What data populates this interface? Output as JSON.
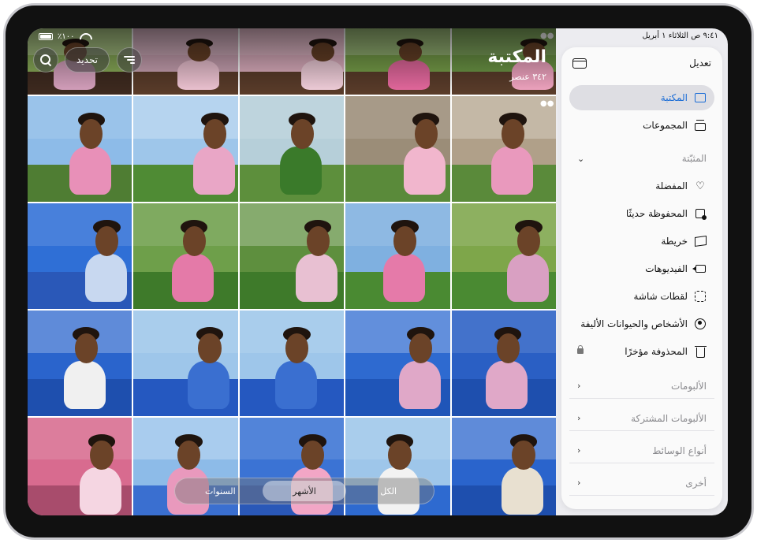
{
  "status": {
    "time_date": "٩:٤١ ص  الثلاثاء ١ أبريل",
    "battery": "٪١٠٠"
  },
  "header": {
    "title": "المكتبة",
    "count": "٣٤٢ عنصر",
    "select_label": "تحديد"
  },
  "bottom_tabs": {
    "all": "الكل",
    "months": "الأشهر",
    "years": "السنوات",
    "selected": "الأشهر"
  },
  "sidebar": {
    "edit_label": "تعديل",
    "items": [
      {
        "label": "المكتبة",
        "icon": "photo-library-icon"
      },
      {
        "label": "المجموعات",
        "icon": "collections-icon"
      }
    ],
    "pinned_header": "المثبّتة",
    "pinned": [
      {
        "label": "المفضلة",
        "icon": "heart-icon"
      },
      {
        "label": "المحفوظة حديثًا",
        "icon": "import-icon"
      },
      {
        "label": "خريطة",
        "icon": "map-icon"
      },
      {
        "label": "الفيديوهات",
        "icon": "video-icon"
      },
      {
        "label": "لقطات شاشة",
        "icon": "screenshot-icon"
      },
      {
        "label": "الأشخاص والحيوانات الأليفة",
        "icon": "person-icon"
      },
      {
        "label": "المحذوفة مؤخرًا",
        "icon": "trash-icon"
      }
    ],
    "sections": [
      {
        "label": "الألبومات"
      },
      {
        "label": "الألبومات المشتركة"
      },
      {
        "label": "أنواع الوسائط"
      },
      {
        "label": "أخرى"
      }
    ]
  },
  "colors": {
    "accent": "#1a6cd6",
    "sidebar_bg": "#ececf0",
    "bouncy_blue": "#2f6fd6",
    "grass": "#5a8f3a",
    "sky": "#8dbbe8"
  }
}
